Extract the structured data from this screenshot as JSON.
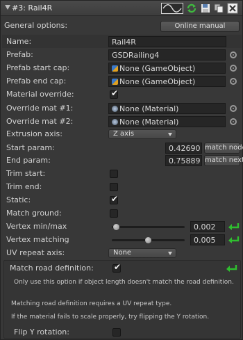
{
  "header": {
    "title": "#3: Rail4R"
  },
  "general": {
    "label": "General options:",
    "online_manual": "Online manual"
  },
  "fields": {
    "name_label": "Name:",
    "name_value": "Rail4R",
    "prefab_label": "Prefab:",
    "prefab_value": "GSDRailing4",
    "start_cap_label": "Prefab start cap:",
    "start_cap_value": "None (GameObject)",
    "end_cap_label": "Prefab end cap:",
    "end_cap_value": "None (GameObject)",
    "mat_override_label": "Material override:",
    "mat1_label": "Override mat #1:",
    "mat1_value": "None (Material)",
    "mat2_label": "Override mat #2:",
    "mat2_value": "None (Material)",
    "extrusion_label": "Extrusion axis:",
    "extrusion_value": "Z axis",
    "start_param_label": "Start param:",
    "start_param_value": "0.42690",
    "match_node": "match node",
    "end_param_label": "End param:",
    "end_param_value": "0.75889",
    "match_next": "match next",
    "trim_start_label": "Trim start:",
    "trim_end_label": "Trim end:",
    "static_label": "Static:",
    "match_ground_label": "Match ground:",
    "vertex_minmax_label": "Vertex min/max",
    "vertex_minmax_value": "0.002",
    "vertex_minmax_slider": 0.02,
    "vertex_matching_label": "Vertex matching",
    "vertex_matching_value": "0.005",
    "vertex_matching_slider": 0.5,
    "uv_repeat_label": "UV repeat axis:",
    "uv_repeat_value": "None"
  },
  "checks": {
    "material_override": true,
    "trim_start": false,
    "trim_end": false,
    "static": true,
    "match_ground": false,
    "match_road_definition": true,
    "flip_y_rotation": false
  },
  "road_def": {
    "label": "Match road definition:",
    "note1": "Only use this option if object length doesn't match the road definition.",
    "note2": "Matching road definition requires a UV repeat type.",
    "note3": "If the material fails to scale properly, try flipping the Y rotation.",
    "flip_label": "Flip Y rotation:"
  },
  "colors": {
    "reset_arrow": "#2fbf2f",
    "refresh_icon": "#3fb83f",
    "prefab_icon": "#3a78c8"
  }
}
